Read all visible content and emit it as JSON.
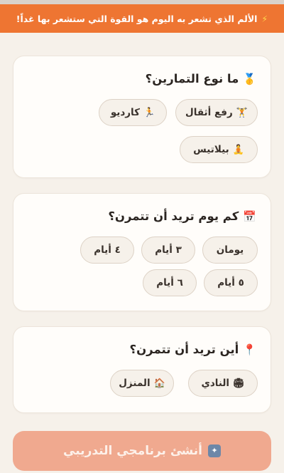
{
  "banner": {
    "text": "الألم الذي تشعر به اليوم هو القوة التي ستشعر بها غداً!",
    "icon": "lightning-icon",
    "color": "#ee7532"
  },
  "exercise_type": {
    "title": "ما نوع التمارين؟",
    "title_icon": "medal-icon",
    "options": [
      {
        "label": "رفع أثقال",
        "icon": "weightlifter-icon"
      },
      {
        "label": "كارديو",
        "icon": "runner-icon"
      },
      {
        "label": "بيلاتيس",
        "icon": "yoga-icon"
      }
    ]
  },
  "days": {
    "title": "كم يوم تريد أن تتمرن؟",
    "title_icon": "calendar-icon",
    "options": [
      {
        "label": "يومان"
      },
      {
        "label": "٣ أيام"
      },
      {
        "label": "٤ أيام"
      },
      {
        "label": "٥ أيام"
      },
      {
        "label": "٦ أيام"
      }
    ]
  },
  "location": {
    "title": "أين تريد أن تتمرن؟",
    "title_icon": "pin-icon",
    "options": [
      {
        "label": "النادي",
        "icon": "stadium-icon"
      },
      {
        "label": "المنزل",
        "icon": "house-icon"
      }
    ]
  },
  "cta": {
    "label": "أنشئ برنامجي التدريبي",
    "icon": "stars-icon",
    "color": "#f0a98f"
  }
}
